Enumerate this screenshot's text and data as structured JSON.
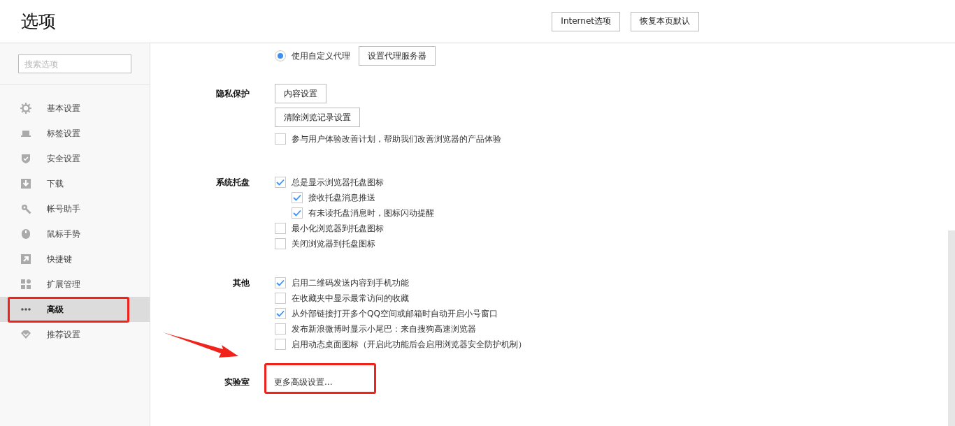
{
  "window": {
    "title": "选项"
  },
  "header_buttons": [
    "Internet选项",
    "恢复本页默认"
  ],
  "search": {
    "placeholder": "搜索选项"
  },
  "sidebar": {
    "items": [
      {
        "label": "基本设置",
        "selected": false,
        "highlighted": false
      },
      {
        "label": "标签设置",
        "selected": false,
        "highlighted": false
      },
      {
        "label": "安全设置",
        "selected": false,
        "highlighted": false
      },
      {
        "label": "下载",
        "selected": false,
        "highlighted": false
      },
      {
        "label": "帐号助手",
        "selected": false,
        "highlighted": false
      },
      {
        "label": "鼠标手势",
        "selected": false,
        "highlighted": false
      },
      {
        "label": "快捷键",
        "selected": false,
        "highlighted": false
      },
      {
        "label": "扩展管理",
        "selected": false,
        "highlighted": false
      },
      {
        "label": "高级",
        "selected": true,
        "highlighted": true
      },
      {
        "label": "推荐设置",
        "selected": false,
        "highlighted": false
      }
    ]
  },
  "sections": [
    {
      "items": [
        {
          "kind": "radio",
          "label": "使用自定义代理",
          "selected": true,
          "button": "设置代理服务器"
        }
      ]
    },
    {
      "label": "隐私保护",
      "items": [
        {
          "kind": "button",
          "label": "内容设置"
        },
        {
          "kind": "button",
          "label": "清除浏览记录设置"
        },
        {
          "kind": "checkbox",
          "label": "参与用户体验改善计划，帮助我们改善浏览器的产品体验",
          "checked": false
        }
      ]
    },
    {
      "label": "系统托盘",
      "items": [
        {
          "kind": "checkbox",
          "label": "总是显示浏览器托盘图标",
          "checked": true,
          "children": [
            {
              "kind": "checkbox",
              "label": "接收托盘消息推送",
              "checked": true
            },
            {
              "kind": "checkbox",
              "label": "有未读托盘消息时，图标闪动提醒",
              "checked": true
            }
          ]
        },
        {
          "kind": "checkbox",
          "label": "最小化浏览器到托盘图标",
          "checked": false
        },
        {
          "kind": "checkbox",
          "label": "关闭浏览器到托盘图标",
          "checked": false
        }
      ]
    },
    {
      "label": "其他",
      "items": [
        {
          "kind": "checkbox",
          "label": "启用二维码发送内容到手机功能",
          "checked": true
        },
        {
          "kind": "checkbox",
          "label": "在收藏夹中显示最常访问的收藏",
          "checked": false
        },
        {
          "kind": "checkbox",
          "label": "从外部链接打开多个QQ空间或邮箱时自动开启小号窗口",
          "checked": true
        },
        {
          "kind": "checkbox",
          "label": "发布新浪微博时显示小尾巴：来自搜狗高速浏览器",
          "checked": false
        },
        {
          "kind": "checkbox",
          "label": "启用动态桌面图标（开启此功能后会启用浏览器安全防护机制）",
          "checked": false
        }
      ]
    },
    {
      "label": "实验室",
      "items": [
        {
          "kind": "link",
          "label": "更多高级设置...",
          "highlighted": true
        }
      ]
    }
  ],
  "pointer_arrow": true
}
